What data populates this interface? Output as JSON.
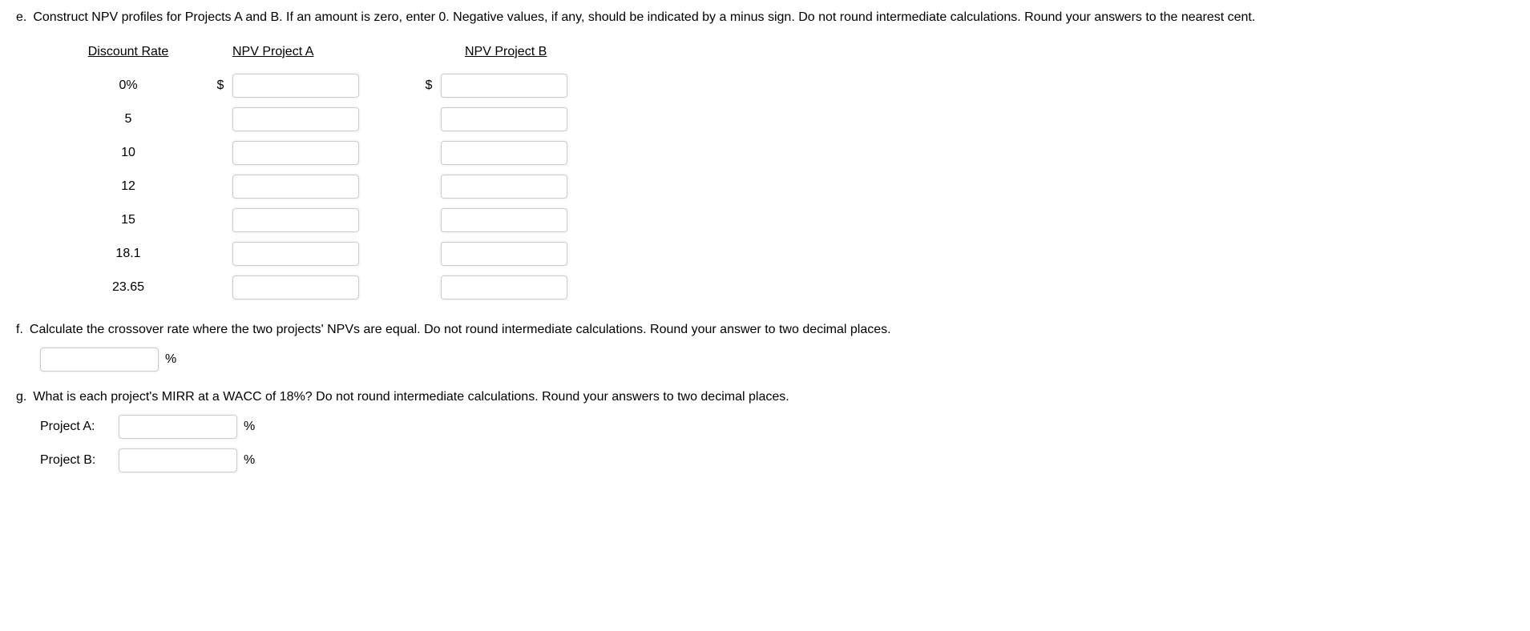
{
  "question_e": {
    "letter": "e.",
    "text": "Construct NPV profiles for Projects A and B. If an amount is zero, enter 0. Negative values, if any, should be indicated by a minus sign. Do not round intermediate calculations. Round your answers to the nearest cent.",
    "headers": {
      "rate": "Discount Rate",
      "a": "NPV Project A",
      "b": "NPV Project B"
    },
    "dollar": "$",
    "rows": [
      {
        "rate": "0%"
      },
      {
        "rate": "5"
      },
      {
        "rate": "10"
      },
      {
        "rate": "12"
      },
      {
        "rate": "15"
      },
      {
        "rate": "18.1"
      },
      {
        "rate": "23.65"
      }
    ]
  },
  "question_f": {
    "letter": "f.",
    "text": "Calculate the crossover rate where the two projects' NPVs are equal. Do not round intermediate calculations. Round your answer to two decimal places.",
    "unit": "%"
  },
  "question_g": {
    "letter": "g.",
    "text": "What is each project's MIRR at a WACC of 18%? Do not round intermediate calculations. Round your answers to two decimal places.",
    "project_a_label": "Project A:",
    "project_b_label": "Project B:",
    "unit": "%"
  }
}
